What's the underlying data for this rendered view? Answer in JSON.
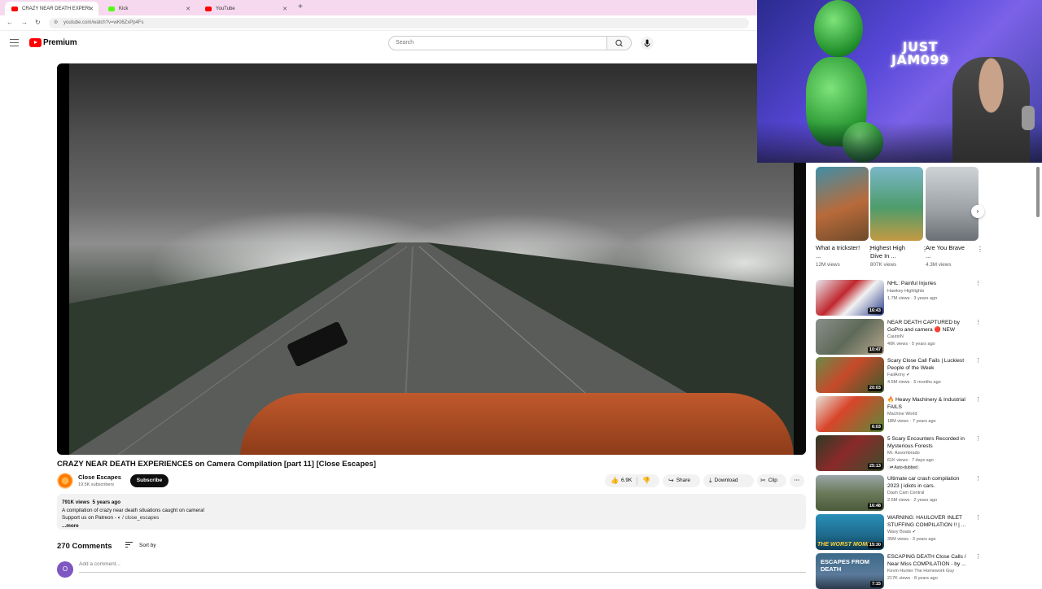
{
  "browser": {
    "tabs": [
      {
        "label": "CRAZY NEAR DEATH EXPERI",
        "active": true
      },
      {
        "label": "Kick",
        "active": false
      },
      {
        "label": "YouTube",
        "active": false
      }
    ],
    "new_tab": "+",
    "url": "youtube.com/watch?v=wKl6ZxPp4Fs"
  },
  "header": {
    "logo_text": "Premium",
    "search_placeholder": "Search"
  },
  "video": {
    "title": "CRAZY NEAR DEATH EXPERIENCES on Camera Compilation [part 11] [Close Escapes]",
    "channel": "Close Escapes",
    "subscribers": "19.5K subscribers",
    "subscribe_label": "Subscribe",
    "likes": "6.9K",
    "share_label": "Share",
    "download_label": "Download",
    "clip_label": "Clip",
    "more_actions": "···"
  },
  "description": {
    "views": "791K views",
    "age": "5 years ago",
    "line1": "A compilation of crazy near death situations caught on camera!",
    "line2": "Support us on Patreon -",
    "link": "/ close_escapes",
    "more": "...more"
  },
  "comments": {
    "count_label": "270 Comments",
    "sort_label": "Sort by",
    "avatar_letter": "O",
    "placeholder": "Add a comment..."
  },
  "webcam": {
    "neon_line1": "JUST",
    "neon_line2": "JAM099"
  },
  "shorts": [
    {
      "title": "What a trickster! ...",
      "views": "12M views"
    },
    {
      "title": "Highest High Dive In ...",
      "views": "807K views"
    },
    {
      "title": "Are You Brave ...",
      "views": "4.3M views"
    }
  ],
  "recommended": [
    {
      "title": "NHL: Painful Injuries",
      "channel": "Hawkey Highlights",
      "meta": "1.7M views · 3 years ago",
      "duration": "16:43"
    },
    {
      "title": "NEAR DEATH CAPTURED by GoPro and camera 🔴 NEW",
      "channel": "CautioN",
      "meta": "40K views · 5 years ago",
      "duration": "10:47"
    },
    {
      "title": "Scary Close Call Fails | Luckiest People of the Week",
      "channel": "FailArmy ✔",
      "meta": "4.5M views · 5 months ago",
      "duration": "20:03"
    },
    {
      "title": "🔥 Heavy Machinery & Industrial FAILS",
      "channel": "Machine World",
      "meta": "18M views · 7 years ago",
      "duration": "6:03"
    },
    {
      "title": "5 Scary Encounters Recorded in Mysterious Forests",
      "channel": "Mr. Assombrado",
      "meta": "61K views · 7 days ago",
      "badge": "Auto-dubbed",
      "duration": "25:13"
    },
    {
      "title": "Ultimate car crash compilation 2023 | idiots in cars.",
      "channel": "Dash Cam Central",
      "meta": "2.5M views · 2 years ago",
      "duration": "16:48"
    },
    {
      "title": "WARNING: HAULOVER INLET STUFFING COMPILATION !! | ...",
      "channel": "Wavy Boats ✔",
      "meta": "35M views · 3 years ago",
      "duration": "15:30",
      "thumb_text": "THE WORST MOMEN"
    },
    {
      "title": "ESCAPING DEATH Close Calls / Near Miss COMPILATION - by ...",
      "channel": "Kevin Hunter The Homework Guy",
      "meta": "217K views · 8 years ago",
      "duration": "7:15",
      "thumb_text": "ESCAPES FROM DEATH"
    }
  ],
  "colors": {
    "tabbar": "#f6d9ee",
    "brand_red": "#ff0000",
    "subscribe_bg": "#0f0f0f"
  }
}
